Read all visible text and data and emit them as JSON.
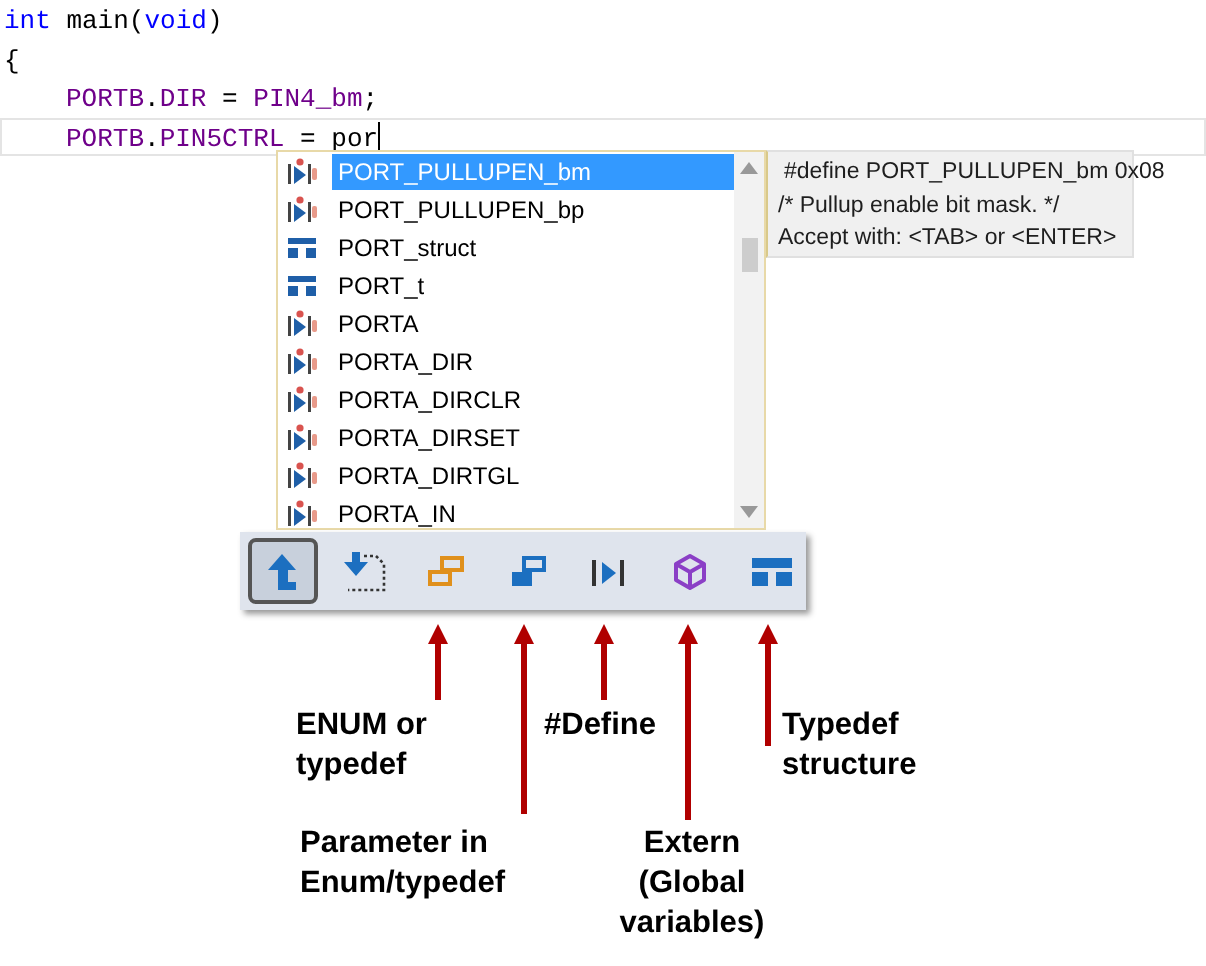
{
  "code_lines": [
    {
      "current": false,
      "tokens": [
        {
          "kind": "keyword",
          "text": "int"
        },
        {
          "kind": "plain",
          "text": " main("
        },
        {
          "kind": "keyword",
          "text": "void"
        },
        {
          "kind": "plain",
          "text": ")"
        }
      ]
    },
    {
      "current": false,
      "tokens": [
        {
          "kind": "plain",
          "text": "{"
        }
      ]
    },
    {
      "current": false,
      "indented": true,
      "tokens": [
        {
          "kind": "macro",
          "text": "PORTB"
        },
        {
          "kind": "plain",
          "text": "."
        },
        {
          "kind": "macro",
          "text": "DIR"
        },
        {
          "kind": "plain",
          "text": " = "
        },
        {
          "kind": "macro",
          "text": "PIN4_bm"
        },
        {
          "kind": "plain",
          "text": ";"
        }
      ]
    },
    {
      "current": true,
      "indented": true,
      "tokens": [
        {
          "kind": "macro",
          "text": "PORTB"
        },
        {
          "kind": "plain",
          "text": "."
        },
        {
          "kind": "macro",
          "text": "PIN5CTRL"
        },
        {
          "kind": "plain",
          "text": " = "
        },
        {
          "kind": "plain",
          "text": "por"
        }
      ]
    }
  ],
  "completion_list": {
    "items": [
      {
        "label": "PORT_PULLUPEN_bm",
        "kind": "define",
        "selected": true
      },
      {
        "label": "PORT_PULLUPEN_bp",
        "kind": "define",
        "selected": false
      },
      {
        "label": "PORT_struct",
        "kind": "struct",
        "selected": false
      },
      {
        "label": "PORT_t",
        "kind": "struct",
        "selected": false
      },
      {
        "label": "PORTA",
        "kind": "define",
        "selected": false
      },
      {
        "label": "PORTA_DIR",
        "kind": "define",
        "selected": false
      },
      {
        "label": "PORTA_DIRCLR",
        "kind": "define",
        "selected": false
      },
      {
        "label": "PORTA_DIRSET",
        "kind": "define",
        "selected": false
      },
      {
        "label": "PORTA_DIRTGL",
        "kind": "define",
        "selected": false
      },
      {
        "label": "PORTA_IN",
        "kind": "define",
        "selected": false
      }
    ]
  },
  "tooltip": {
    "lines": [
      "#define PORT_PULLUPEN_bm 0x08",
      "/* Pullup enable bit mask. */",
      "Accept with: <TAB> or <ENTER>"
    ]
  },
  "filter_toolbar": [
    {
      "kind": "up",
      "selected": true
    },
    {
      "kind": "down",
      "selected": false
    },
    {
      "kind": "enum",
      "selected": false
    },
    {
      "kind": "param",
      "selected": false
    },
    {
      "kind": "define",
      "selected": false
    },
    {
      "kind": "extern",
      "selected": false
    },
    {
      "kind": "struct",
      "selected": false
    }
  ],
  "annotations": [
    {
      "label": "ENUM or typedef"
    },
    {
      "label": "Parameter in Enum/typedef"
    },
    {
      "label": "#Define"
    },
    {
      "label": "Extern (Global variables)"
    },
    {
      "label": "Typedef structure"
    }
  ]
}
